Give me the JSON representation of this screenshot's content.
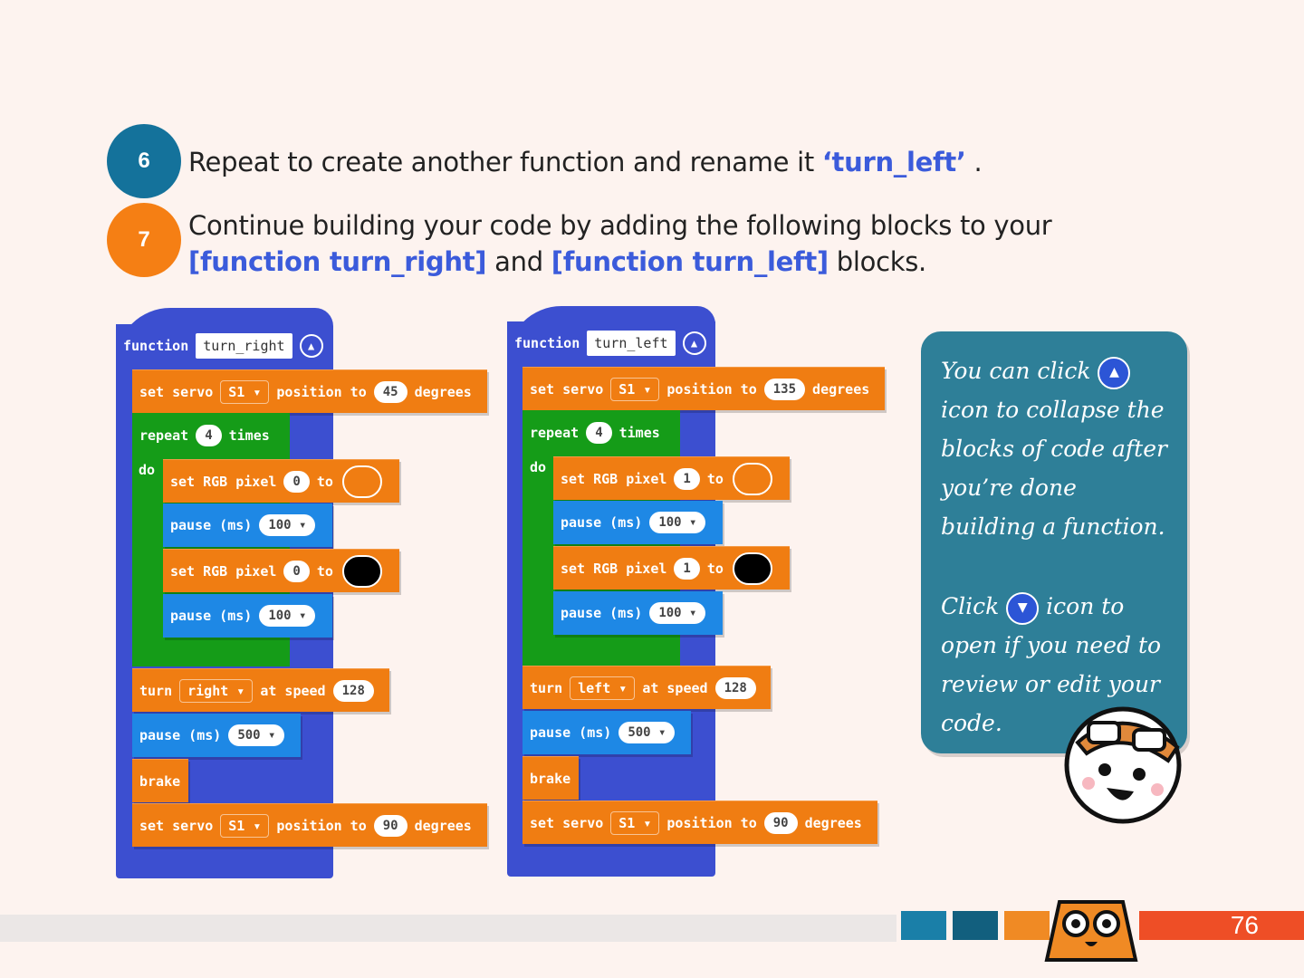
{
  "steps": [
    {
      "number": "6",
      "text_before": "Repeat to create another function and rename it ",
      "highlight": "‘turn_left’",
      "text_after": " ."
    },
    {
      "number": "7",
      "line1": "Continue building your code by adding the following blocks to your",
      "hl1": "[function turn_right]",
      "mid": " and ",
      "hl2": "[function turn_left]",
      "end": " blocks."
    }
  ],
  "left_fn": {
    "keyword": "function",
    "name": "turn_right",
    "collapse_icon": "chevron-up-icon",
    "servo1": {
      "set": "set servo",
      "servo": "S1 ▾",
      "position": "position to",
      "value": "45",
      "unit": "degrees"
    },
    "repeat": {
      "label": "repeat",
      "count": "4",
      "times": "times",
      "do": "do"
    },
    "rgb1": {
      "label": "set RGB pixel",
      "index": "0",
      "to": "to",
      "color": "#f07d12"
    },
    "pause1": {
      "label": "pause (ms)",
      "value": "100 ▾"
    },
    "rgb2": {
      "label": "set RGB pixel",
      "index": "0",
      "to": "to",
      "color": "#000000"
    },
    "pause2": {
      "label": "pause (ms)",
      "value": "100 ▾"
    },
    "turn": {
      "label": "turn",
      "dir": "right ▾",
      "speed_label": "at speed",
      "speed": "128"
    },
    "pause3": {
      "label": "pause (ms)",
      "value": "500 ▾"
    },
    "brake": "brake",
    "servo2": {
      "set": "set servo",
      "servo": "S1 ▾",
      "position": "position to",
      "value": "90",
      "unit": "degrees"
    }
  },
  "right_fn": {
    "keyword": "function",
    "name": "turn_left",
    "collapse_icon": "chevron-up-icon",
    "servo1": {
      "set": "set servo",
      "servo": "S1 ▾",
      "position": "position to",
      "value": "135",
      "unit": "degrees"
    },
    "repeat": {
      "label": "repeat",
      "count": "4",
      "times": "times",
      "do": "do"
    },
    "rgb1": {
      "label": "set RGB pixel",
      "index": "1",
      "to": "to",
      "color": "#f07d12"
    },
    "pause1": {
      "label": "pause (ms)",
      "value": "100 ▾"
    },
    "rgb2": {
      "label": "set RGB pixel",
      "index": "1",
      "to": "to",
      "color": "#000000"
    },
    "pause2": {
      "label": "pause (ms)",
      "value": "100 ▾"
    },
    "turn": {
      "label": "turn",
      "dir": "left ▾",
      "speed_label": "at speed",
      "speed": "128"
    },
    "pause3": {
      "label": "pause (ms)",
      "value": "500 ▾"
    },
    "brake": "brake",
    "servo2": {
      "set": "set servo",
      "servo": "S1 ▾",
      "position": "position to",
      "value": "90",
      "unit": "degrees"
    }
  },
  "tip": {
    "p1_a": "You can click ",
    "p1_b": " icon to collapse the blocks of code after you’re done building a function.",
    "p2_a": "Click ",
    "p2_b": " icon to open if you need to review or edit your code.",
    "icon_up": "chevron-up-icon",
    "icon_down": "chevron-down-icon"
  },
  "footer": {
    "page_number": "76",
    "colors": [
      "#1a7fa8",
      "#125f7e",
      "#f08a24",
      "#ee4e26"
    ]
  }
}
